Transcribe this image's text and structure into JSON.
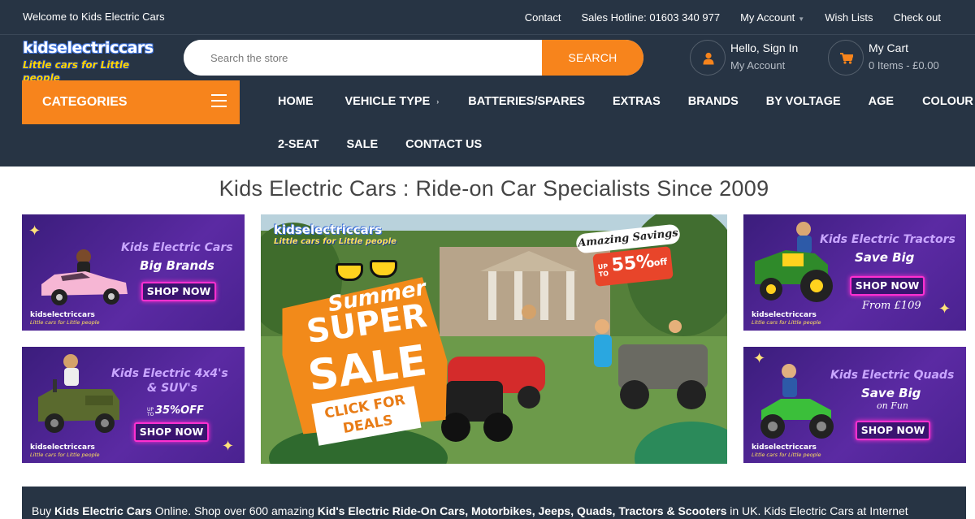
{
  "topbar": {
    "welcome": "Welcome to Kids Electric Cars",
    "links": [
      "Contact",
      "Sales Hotline: 01603 340 977",
      "My Account",
      "Wish Lists",
      "Check out"
    ]
  },
  "logo": {
    "line1": "kidselectriccars",
    "line2": "Little cars for Little people"
  },
  "search": {
    "placeholder": "Search the store",
    "button": "SEARCH"
  },
  "account": {
    "title": "Hello, Sign In",
    "subtitle": "My Account",
    "icon": "user-icon"
  },
  "cart": {
    "title": "My Cart",
    "subtitle": "0 Items - £0.00",
    "icon": "shopping-cart-icon"
  },
  "categories": {
    "label": "CATEGORIES",
    "icon": "hamburger-icon"
  },
  "nav": {
    "row1": [
      "HOME",
      "VEHICLE TYPE",
      "BATTERIES/SPARES",
      "EXTRAS",
      "BRANDS",
      "BY VOLTAGE",
      "AGE",
      "COLOUR"
    ],
    "row2": [
      "2-SEAT",
      "SALE",
      "CONTACT US"
    ]
  },
  "page_title": "Kids Electric Cars : Ride-on Car Specialists Since 2009",
  "banners": {
    "cars": {
      "title": "Kids Electric Cars",
      "sub": "Big Brands",
      "shop": "SHOP NOW"
    },
    "suvs": {
      "title": "Kids Electric 4x4's",
      "title2": "& SUV's",
      "prefix": "UP TO",
      "off": "35%OFF",
      "shop": "SHOP NOW"
    },
    "tractors": {
      "title": "Kids Electric Tractors",
      "sub": "Save Big",
      "shop": "SHOP NOW",
      "extra": "From £109"
    },
    "quads": {
      "title": "Kids Electric Quads",
      "sub": "Save Big",
      "sub2": "on Fun",
      "shop": "SHOP NOW"
    },
    "minilogo": {
      "a": "kidselectriccars",
      "b": "Little cars for Little people"
    }
  },
  "hero": {
    "logo_a": "kidselectriccars",
    "logo_b": "Little cars for Little people",
    "savings": "Amazing Savings",
    "upto": "UP TO",
    "percent": "55%",
    "off": "off",
    "summer": "Summer",
    "super": "SUPER",
    "sale": "SALE",
    "click1": "CLICK FOR",
    "click2": "DEALS"
  },
  "footer": {
    "prefix": "Buy ",
    "bold1": "Kids Electric Cars",
    "mid": " Online. Shop over 600 amazing ",
    "bold2": "Kid's Electric Ride-On Cars, Motorbikes, Jeeps, Quads, Tractors & Scooters",
    "suffix": " in UK. Kids Electric Cars at Internet"
  },
  "colors": {
    "dark": "#273444",
    "accent": "#f7841c",
    "neon": "#ff2fd0"
  }
}
